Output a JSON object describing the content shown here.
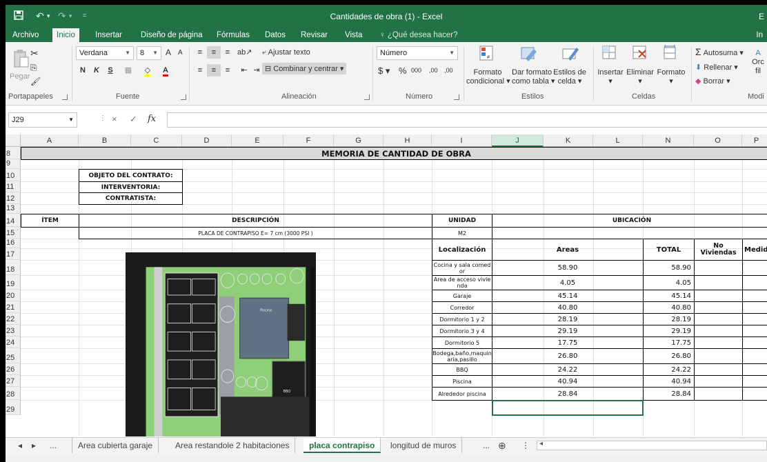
{
  "window": {
    "title": "Cantidades de obra (1) - Excel",
    "edge_label": "E"
  },
  "quick_access": {
    "save_icon": "save-icon",
    "undo_icon": "undo-icon",
    "redo_icon": "redo-icon",
    "more_icon": "customize-icon"
  },
  "tabs": [
    "Archivo",
    "Inicio",
    "Insertar",
    "Diseño de página",
    "Fórmulas",
    "Datos",
    "Revisar",
    "Vista"
  ],
  "active_tab": "Inicio",
  "search": {
    "label": "¿Qué desea hacer?",
    "icon": "lightbulb-icon"
  },
  "tabs_edge": "In",
  "ribbon": {
    "clipboard": {
      "label": "Portapapeles",
      "paste": "Pegar"
    },
    "font": {
      "label": "Fuente",
      "name": "Verdana",
      "size": "8",
      "grow": "A",
      "shrink": "A",
      "bold": "N",
      "italic": "K",
      "underline": "S"
    },
    "alignment": {
      "label": "Alineación",
      "wrap": "Ajustar texto",
      "merge": "Combinar y centrar"
    },
    "number": {
      "label": "Número",
      "format": "Número",
      "currency": "$",
      "percent": "%",
      "thousands": "000",
      "inc_dec": ",00",
      "dec_dec": ",00"
    },
    "styles": {
      "label": "Estilos",
      "conditional": "Formato",
      "conditional_2": "condicional",
      "as_table": "Dar formato",
      "as_table_2": "como tabla",
      "cell_styles": "Estilos de",
      "cell_styles_2": "celda"
    },
    "cells": {
      "label": "Celdas",
      "insert": "Insertar",
      "delete": "Eliminar",
      "format": "Formato"
    },
    "editing": {
      "label": "Modi",
      "autosum": "Autosuma",
      "fill": "Rellenar",
      "clear": "Borrar",
      "sort": "Orc",
      "sort_2": "fil"
    }
  },
  "formula_bar": {
    "name_box": "J29",
    "cancel": "×",
    "enter": "✓",
    "fx": "fx",
    "value": ""
  },
  "columns": [
    "A",
    "B",
    "C",
    "D",
    "E",
    "F",
    "G",
    "H",
    "I",
    "J",
    "K",
    "L",
    "N",
    "O",
    "P"
  ],
  "rows": [
    "8",
    "9",
    "10",
    "11",
    "12",
    "13",
    "14",
    "15",
    "16",
    "17",
    "18",
    "19",
    "20",
    "21",
    "22",
    "23",
    "24",
    "25",
    "26",
    "27",
    "28",
    "29"
  ],
  "sheet": {
    "title": "MEMORIA DE CANTIDAD DE OBRA",
    "objeto": "OBJETO DEL CONTRATO:",
    "interventoria": "INTERVENTORIA:",
    "contratista": "CONTRATISTA:",
    "item_header": "ÍTEM",
    "descripcion_header": "DESCRIPCIÓN",
    "unidad_header": "UNIDAD",
    "ubicacion_header": "UBICACIÓN",
    "descripcion": "PLACA DE CONTRAPISO E= 7 cm (3000 PSI )",
    "unidad": "M2",
    "localizacion_header": "Localización",
    "areas_header": "Areas",
    "total_header": "TOTAL",
    "viviendas_header": "No Viviendas",
    "medida_header": "Medida",
    "floor_plan_labels": [
      "Piscina",
      "BBQ"
    ],
    "items": [
      {
        "localizacion": "Cocina y sala comedor",
        "area": "58.90",
        "total": "58.90"
      },
      {
        "localizacion": "Area de acceso vivienda",
        "area": "4.05",
        "total": "4.05"
      },
      {
        "localizacion": "Garaje",
        "area": "45.14",
        "total": "45.14"
      },
      {
        "localizacion": "Corredor",
        "area": "40.80",
        "total": "40.80"
      },
      {
        "localizacion": "Dormitorio 1 y 2",
        "area": "28.19",
        "total": "28.19"
      },
      {
        "localizacion": "Dormitorio 3 y 4",
        "area": "29.19",
        "total": "29.19"
      },
      {
        "localizacion": "Dormitorio 5",
        "area": "17.75",
        "total": "17.75"
      },
      {
        "localizacion": "Bodega,baño,maquinaria,pasillo",
        "area": "26.80",
        "total": "26.80"
      },
      {
        "localizacion": "BBQ",
        "area": "24.22",
        "total": "24.22"
      },
      {
        "localizacion": "Piscina",
        "area": "40.94",
        "total": "40.94"
      },
      {
        "localizacion": "Alrededor piscina",
        "area": "28.84",
        "total": "28.84"
      }
    ]
  },
  "sheet_tabs": [
    "...",
    "Area cubierta garaje",
    "Area restandole 2 habitaciones",
    "placa contrapiso",
    "longitud de muros",
    "..."
  ],
  "active_sheet": "placa contrapiso",
  "colors": {
    "excel_green": "#217346",
    "selection_green": "#d3e7da"
  }
}
